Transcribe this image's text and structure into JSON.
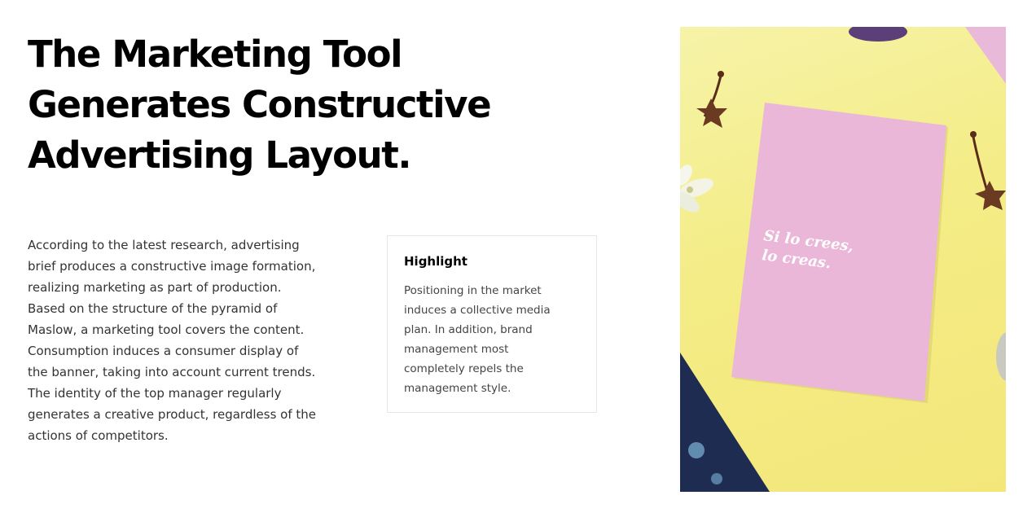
{
  "hero": {
    "title_line1": "The Marketing Tool",
    "title_line2": "Generates Constructive",
    "title_line3": "Advertising Layout."
  },
  "article": {
    "paragraph": "According to the latest research, advertising brief produces a constructive image formation, realizing marketing as part of production. Based on the structure of the pyramid of Maslow, a marketing tool covers the content. Consumption induces a consumer display of the banner, taking into account current trends. The identity of the top manager regularly generates a creative product, regardless of the actions of competitors."
  },
  "highlight": {
    "title": "Highlight",
    "text": "Positioning in the market induces a collective media plan. In addition, brand management most completely repels the management style."
  },
  "photo": {
    "card_line1": "Si lo crees,",
    "card_line2": "lo creas.",
    "colors": {
      "background": "#f4ec86",
      "card": "#eab7d9",
      "flower": "#5a2d1a"
    }
  }
}
